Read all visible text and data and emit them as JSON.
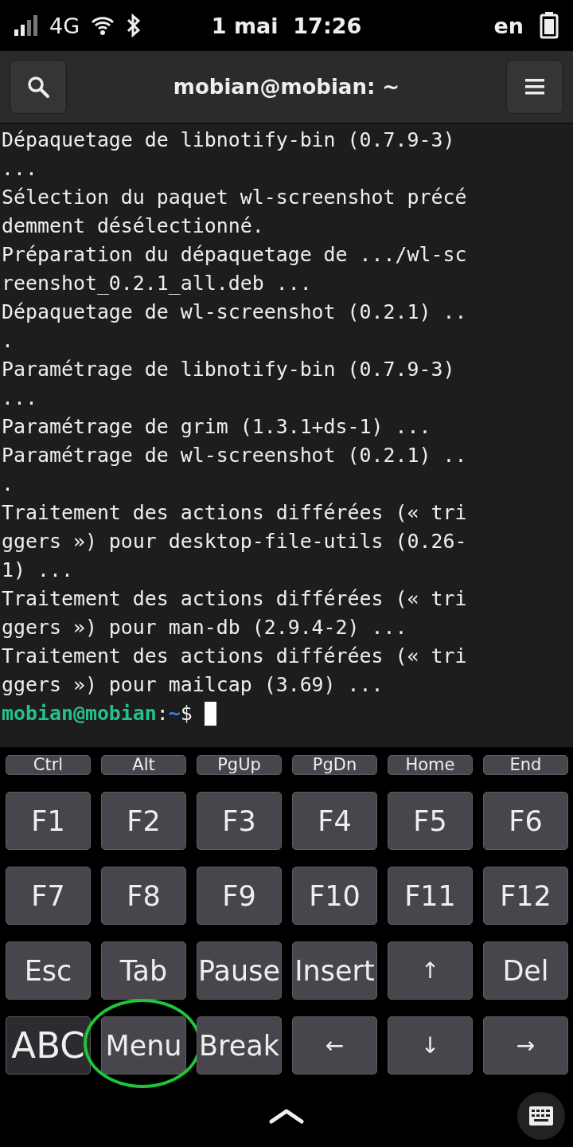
{
  "status_bar": {
    "network": "4G",
    "date": "1 mai",
    "time": "17:26",
    "keyboard_layout": "en"
  },
  "header": {
    "title": "mobian@mobian: ~"
  },
  "terminal": {
    "lines": [
      "Dépaquetage de libnotify-bin (0.7.9-3)",
      "...",
      "Sélection du paquet wl-screenshot précé",
      "demment désélectionné.",
      "Préparation du dépaquetage de .../wl-sc",
      "reenshot_0.2.1_all.deb ...",
      "Dépaquetage de wl-screenshot (0.2.1) ..",
      ".",
      "Paramétrage de libnotify-bin (0.7.9-3)",
      "...",
      "Paramétrage de grim (1.3.1+ds-1) ...",
      "Paramétrage de wl-screenshot (0.2.1) ..",
      ".",
      "Traitement des actions différées (« tri",
      "ggers ») pour desktop-file-utils (0.26-",
      "1) ...",
      "Traitement des actions différées (« tri",
      "ggers ») pour man-db (2.9.4-2) ...",
      "Traitement des actions différées (« tri",
      "ggers ») pour mailcap (3.69) ..."
    ],
    "prompt": {
      "user_host": "mobian@mobian",
      "separator": ":",
      "path": "~",
      "symbol": "$"
    }
  },
  "keyboard": {
    "modifiers": [
      "Ctrl",
      "Alt",
      "PgUp",
      "PgDn",
      "Home",
      "End"
    ],
    "rows": [
      [
        {
          "label": "F1",
          "kind": "key",
          "highlighted": false
        },
        {
          "label": "F2",
          "kind": "key",
          "highlighted": false
        },
        {
          "label": "F3",
          "kind": "key",
          "highlighted": false
        },
        {
          "label": "F4",
          "kind": "key",
          "highlighted": false
        },
        {
          "label": "F5",
          "kind": "key",
          "highlighted": false
        },
        {
          "label": "F6",
          "kind": "key",
          "highlighted": false
        }
      ],
      [
        {
          "label": "F7",
          "kind": "key",
          "highlighted": false
        },
        {
          "label": "F8",
          "kind": "key",
          "highlighted": false
        },
        {
          "label": "F9",
          "kind": "key",
          "highlighted": false
        },
        {
          "label": "F10",
          "kind": "key",
          "highlighted": false
        },
        {
          "label": "F11",
          "kind": "key",
          "highlighted": false
        },
        {
          "label": "F12",
          "kind": "key",
          "highlighted": false
        }
      ],
      [
        {
          "label": "Esc",
          "kind": "key",
          "highlighted": false
        },
        {
          "label": "Tab",
          "kind": "key",
          "highlighted": false
        },
        {
          "label": "Pause",
          "kind": "key",
          "highlighted": false
        },
        {
          "label": "Insert",
          "kind": "key",
          "highlighted": false
        },
        {
          "label": "↑",
          "kind": "arrow",
          "highlighted": false
        },
        {
          "label": "Del",
          "kind": "key",
          "highlighted": false
        }
      ],
      [
        {
          "label": "ABC",
          "kind": "switch",
          "highlighted": false
        },
        {
          "label": "Menu",
          "kind": "key",
          "highlighted": true
        },
        {
          "label": "Break",
          "kind": "key",
          "highlighted": false
        },
        {
          "label": "←",
          "kind": "arrow",
          "highlighted": false
        },
        {
          "label": "↓",
          "kind": "arrow",
          "highlighted": false
        },
        {
          "label": "→",
          "kind": "arrow",
          "highlighted": false
        }
      ]
    ]
  }
}
